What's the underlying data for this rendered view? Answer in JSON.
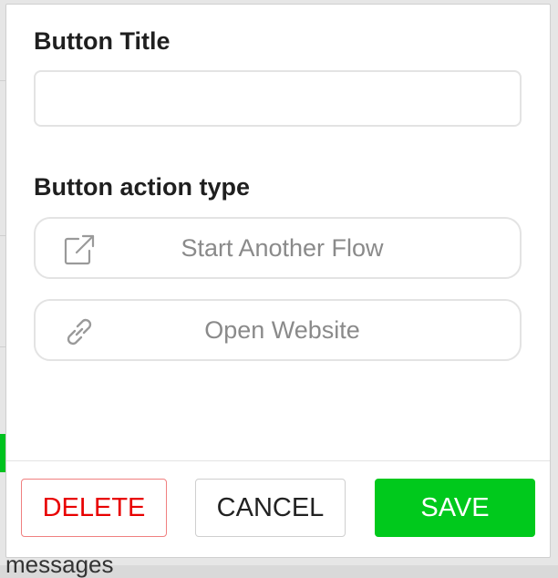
{
  "modal": {
    "title_label": "Button Title",
    "title_value": "",
    "action_type_label": "Button action type",
    "actions": [
      {
        "label": "Start Another Flow",
        "icon": "external-link-icon"
      },
      {
        "label": "Open Website",
        "icon": "link-icon"
      }
    ],
    "footer": {
      "delete_label": "DELETE",
      "cancel_label": "CANCEL",
      "save_label": "SAVE"
    }
  },
  "colors": {
    "save": "#00c91c",
    "delete": "#e80000",
    "muted_text": "#8a8a8a"
  },
  "background": {
    "partial_text": "messages"
  }
}
